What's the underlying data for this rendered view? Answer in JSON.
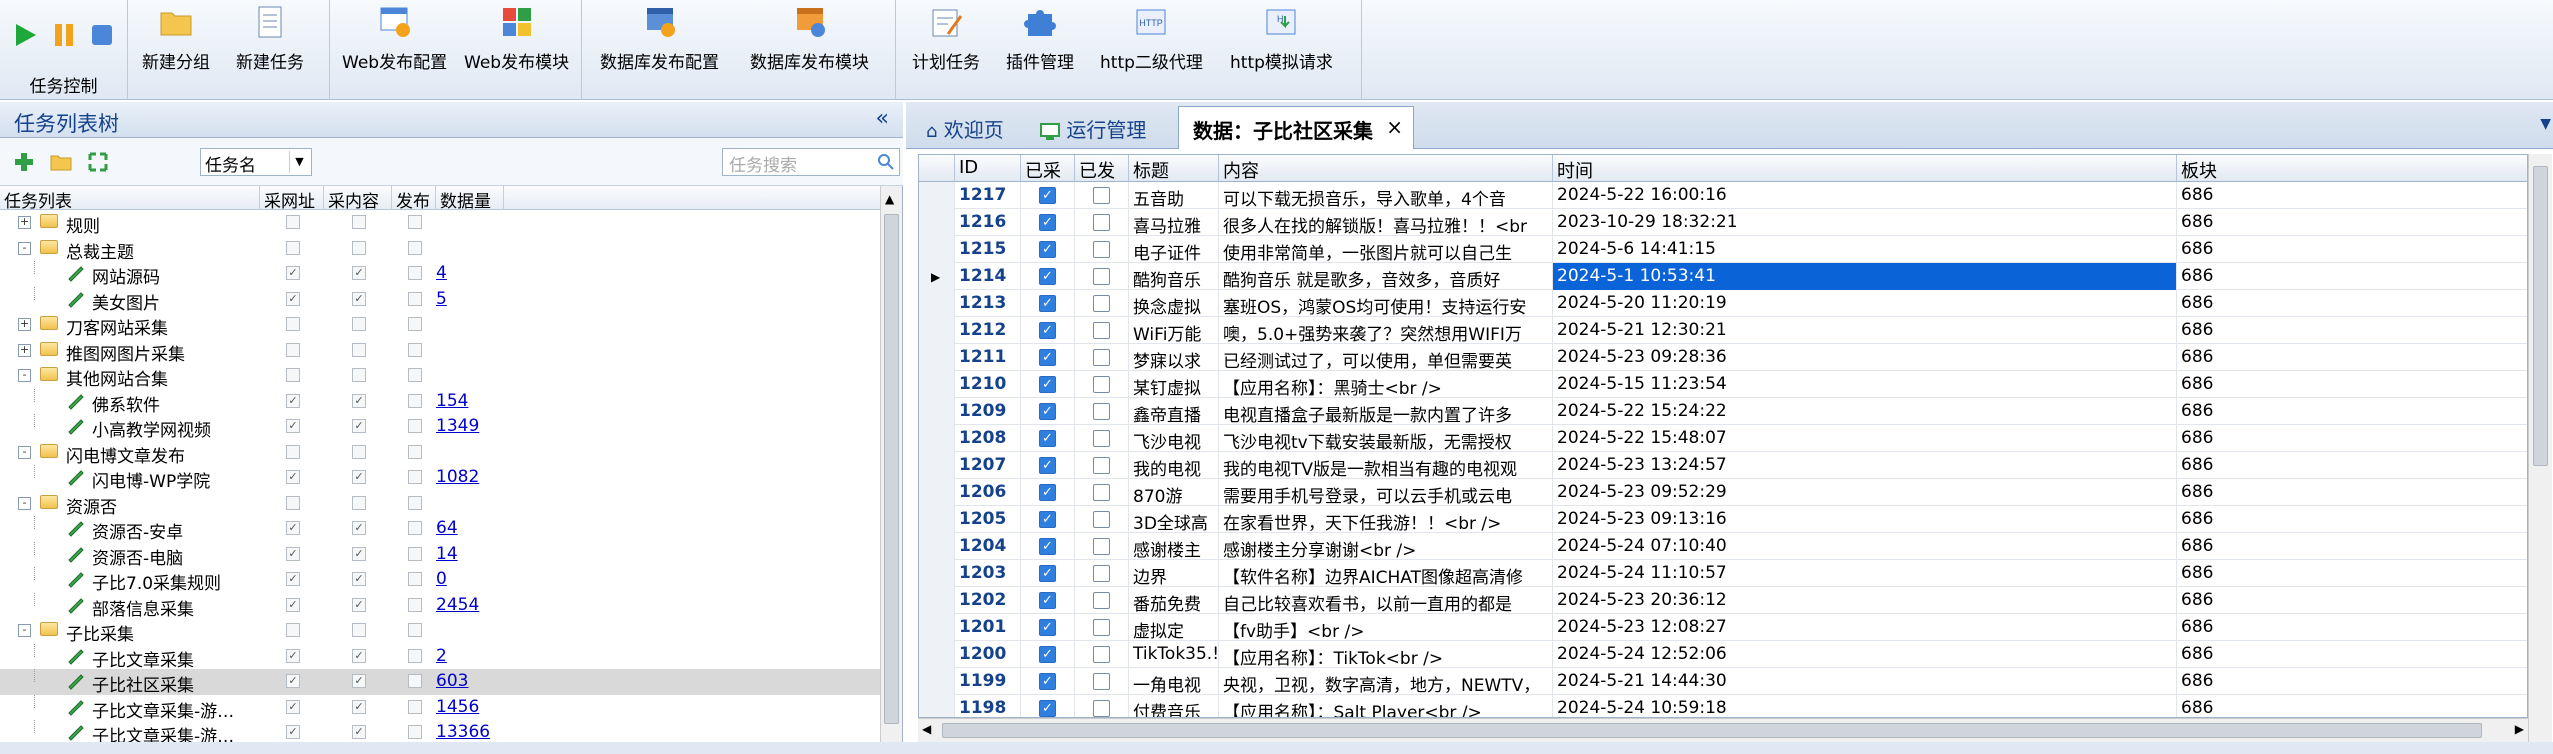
{
  "toolbar": {
    "group_label": "任务控制",
    "buttons": [
      "新建分组",
      "新建任务",
      "Web发布配置",
      "Web发布模块",
      "数据库发布配置",
      "数据库发布模块",
      "计划任务",
      "插件管理",
      "http二级代理",
      "http模拟请求"
    ]
  },
  "left": {
    "title": "任务列表树",
    "collapse": "«",
    "filter_select": "任务名",
    "search_placeholder": "任务搜索",
    "columns": [
      "任务列表",
      "采网址",
      "采内容",
      "发布",
      "数据量"
    ],
    "rows": [
      {
        "name": "规则",
        "level": 0,
        "type": "folder",
        "exp": "+",
        "c1": false,
        "c2": false,
        "c3": false,
        "count": ""
      },
      {
        "name": "总裁主题",
        "level": 0,
        "type": "folder",
        "exp": "-",
        "c1": false,
        "c2": false,
        "c3": false,
        "count": ""
      },
      {
        "name": "网站源码",
        "level": 1,
        "type": "leaf",
        "exp": "",
        "c1": true,
        "c2": true,
        "c3": false,
        "count": "4"
      },
      {
        "name": "美女图片",
        "level": 1,
        "type": "leaf",
        "exp": "",
        "c1": true,
        "c2": true,
        "c3": false,
        "count": "5"
      },
      {
        "name": "刀客网站采集",
        "level": 0,
        "type": "folder",
        "exp": "+",
        "c1": false,
        "c2": false,
        "c3": false,
        "count": ""
      },
      {
        "name": "推图网图片采集",
        "level": 0,
        "type": "folder",
        "exp": "+",
        "c1": false,
        "c2": false,
        "c3": false,
        "count": ""
      },
      {
        "name": "其他网站合集",
        "level": 0,
        "type": "folder",
        "exp": "-",
        "c1": false,
        "c2": false,
        "c3": false,
        "count": ""
      },
      {
        "name": "佛系软件",
        "level": 1,
        "type": "leaf",
        "exp": "",
        "c1": true,
        "c2": true,
        "c3": false,
        "count": "154"
      },
      {
        "name": "小高教学网视频",
        "level": 1,
        "type": "leaf",
        "exp": "",
        "c1": true,
        "c2": true,
        "c3": false,
        "count": "1349"
      },
      {
        "name": "闪电博文章发布",
        "level": 0,
        "type": "folder",
        "exp": "-",
        "c1": false,
        "c2": false,
        "c3": false,
        "count": ""
      },
      {
        "name": "闪电博-WP学院",
        "level": 1,
        "type": "leaf",
        "exp": "",
        "c1": true,
        "c2": true,
        "c3": false,
        "count": "1082"
      },
      {
        "name": "资源否",
        "level": 0,
        "type": "folder",
        "exp": "-",
        "c1": false,
        "c2": false,
        "c3": false,
        "count": ""
      },
      {
        "name": "资源否-安卓",
        "level": 1,
        "type": "leaf",
        "exp": "",
        "c1": true,
        "c2": true,
        "c3": false,
        "count": "64"
      },
      {
        "name": "资源否-电脑",
        "level": 1,
        "type": "leaf",
        "exp": "",
        "c1": true,
        "c2": true,
        "c3": false,
        "count": "14"
      },
      {
        "name": "子比7.0采集规则",
        "level": 1,
        "type": "leaf",
        "exp": "",
        "c1": true,
        "c2": true,
        "c3": false,
        "count": "0"
      },
      {
        "name": "部落信息采集",
        "level": 1,
        "type": "leaf",
        "exp": "",
        "c1": true,
        "c2": true,
        "c3": false,
        "count": "2454"
      },
      {
        "name": "子比采集",
        "level": 0,
        "type": "folder",
        "exp": "-",
        "c1": false,
        "c2": false,
        "c3": false,
        "count": ""
      },
      {
        "name": "子比文章采集",
        "level": 1,
        "type": "leaf",
        "exp": "",
        "c1": true,
        "c2": true,
        "c3": false,
        "count": "2"
      },
      {
        "name": "子比社区采集",
        "level": 1,
        "type": "leaf",
        "exp": "",
        "c1": true,
        "c2": true,
        "c3": false,
        "count": "603",
        "selected": true
      },
      {
        "name": "子比文章采集-游…",
        "level": 1,
        "type": "leaf",
        "exp": "",
        "c1": true,
        "c2": true,
        "c3": false,
        "count": "1456"
      },
      {
        "name": "子比文章采集-游…",
        "level": 1,
        "type": "leaf",
        "exp": "",
        "c1": true,
        "c2": true,
        "c3": false,
        "count": "13366"
      }
    ]
  },
  "tabs": [
    {
      "label": "欢迎页",
      "icon": "home-icon"
    },
    {
      "label": "运行管理",
      "icon": "monitor-icon"
    },
    {
      "label": "数据：子比社区采集",
      "icon": "",
      "close": "×"
    }
  ],
  "grid": {
    "columns": [
      "ID",
      "已采",
      "已发",
      "标题",
      "内容",
      "时间",
      "板块"
    ],
    "rows": [
      {
        "id": "1217",
        "c": true,
        "p": false,
        "title": "五音助",
        "content": "可以下载无损音乐，导入歌单，4个音",
        "time": "2024-5-22 16:00:16",
        "board": "686"
      },
      {
        "id": "1216",
        "c": true,
        "p": false,
        "title": "喜马拉雅",
        "content": "很多人在找的解锁版！喜马拉雅！！<br",
        "time": "2023-10-29 18:32:21",
        "board": "686"
      },
      {
        "id": "1215",
        "c": true,
        "p": false,
        "title": "电子证件",
        "content": "使用非常简单，一张图片就可以自己生",
        "time": "2024-5-6 14:41:15",
        "board": "686"
      },
      {
        "id": "1214",
        "c": true,
        "p": false,
        "title": "酷狗音乐",
        "content": "酷狗音乐 就是歌多，音效多，音质好",
        "time": "2024-5-1 10:53:41",
        "board": "686",
        "current": true
      },
      {
        "id": "1213",
        "c": true,
        "p": false,
        "title": "换念虚拟",
        "content": "塞班OS，鸿蒙OS均可使用！支持运行安",
        "time": "2024-5-20 11:20:19",
        "board": "686"
      },
      {
        "id": "1212",
        "c": true,
        "p": false,
        "title": "WiFi万能",
        "content": "噢，5.0+强势来袭了？突然想用WIFI万",
        "time": "2024-5-21 12:30:21",
        "board": "686"
      },
      {
        "id": "1211",
        "c": true,
        "p": false,
        "title": "梦寐以求",
        "content": "已经测试过了，可以使用，单但需要英",
        "time": "2024-5-23 09:28:36",
        "board": "686"
      },
      {
        "id": "1210",
        "c": true,
        "p": false,
        "title": "某钉虚拟",
        "content": "【应用名称】：黑骑士<br />",
        "time": "2024-5-15 11:23:54",
        "board": "686"
      },
      {
        "id": "1209",
        "c": true,
        "p": false,
        "title": "鑫帝直播",
        "content": "电视直播盒子最新版是一款内置了许多",
        "time": "2024-5-22 15:24:22",
        "board": "686"
      },
      {
        "id": "1208",
        "c": true,
        "p": false,
        "title": "飞沙电视",
        "content": "飞沙电视tv下载安装最新版，无需授权",
        "time": "2024-5-22 15:48:07",
        "board": "686"
      },
      {
        "id": "1207",
        "c": true,
        "p": false,
        "title": "我的电视",
        "content": "我的电视TV版是一款相当有趣的电视观",
        "time": "2024-5-23 13:24:57",
        "board": "686"
      },
      {
        "id": "1206",
        "c": true,
        "p": false,
        "title": "870游",
        "content": "需要用手机号登录，可以云手机或云电",
        "time": "2024-5-23 09:52:29",
        "board": "686"
      },
      {
        "id": "1205",
        "c": true,
        "p": false,
        "title": "3D全球高",
        "content": "在家看世界，天下任我游！！<br />",
        "time": "2024-5-23 09:13:16",
        "board": "686"
      },
      {
        "id": "1204",
        "c": true,
        "p": false,
        "title": "感谢楼主",
        "content": "感谢楼主分享谢谢<br />",
        "time": "2024-5-24 07:10:40",
        "board": "686"
      },
      {
        "id": "1203",
        "c": true,
        "p": false,
        "title": "边界",
        "content": "【软件名称】边界AICHAT图像超高清修",
        "time": "2024-5-24 11:10:57",
        "board": "686"
      },
      {
        "id": "1202",
        "c": true,
        "p": false,
        "title": "番茄免费",
        "content": "自己比较喜欢看书，以前一直用的都是",
        "time": "2024-5-23 20:36:12",
        "board": "686"
      },
      {
        "id": "1201",
        "c": true,
        "p": false,
        "title": "虚拟定",
        "content": "【fv助手】<br />",
        "time": "2024-5-23 12:08:27",
        "board": "686"
      },
      {
        "id": "1200",
        "c": true,
        "p": false,
        "title": "TikTok35.!",
        "content": "【应用名称】：TikTok<br />",
        "time": "2024-5-24 12:52:06",
        "board": "686"
      },
      {
        "id": "1199",
        "c": true,
        "p": false,
        "title": "一角电视",
        "content": "央视，卫视，数字高清，地方，NEWTV，",
        "time": "2024-5-21 14:44:30",
        "board": "686"
      },
      {
        "id": "1198",
        "c": true,
        "p": false,
        "title": "付费音乐",
        "content": "【应用名称】：Salt Player<br />",
        "time": "2024-5-24 10:59:18",
        "board": "686"
      }
    ]
  },
  "colors": {
    "accent": "#0a64d8",
    "link": "#0000cc",
    "header_text": "#15428b"
  }
}
